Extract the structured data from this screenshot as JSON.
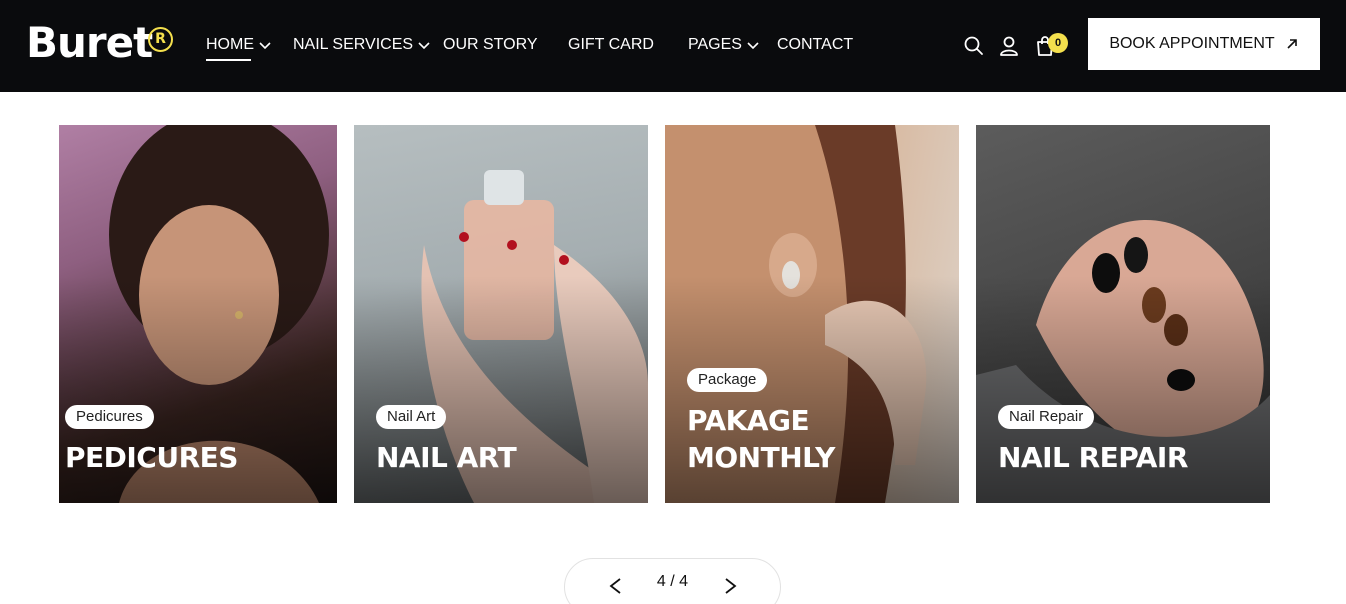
{
  "brand": {
    "name": "Buret",
    "mark": "R"
  },
  "nav": {
    "home": "HOME",
    "nail_services": "NAIL SERVICES",
    "our_story": "OUR STORY",
    "gift_card": "GIFT CARD",
    "pages": "PAGES",
    "contact": "CONTACT"
  },
  "header_icons": {
    "search": "search-icon",
    "user": "user-icon",
    "cart": "cart-icon"
  },
  "cart": {
    "count": "0"
  },
  "cta": {
    "label": "BOOK APPOINTMENT",
    "icon": "arrow-up-right-icon"
  },
  "cards": [
    {
      "tag": "Pedicures",
      "title": "PEDICURES"
    },
    {
      "tag": "Nail Art",
      "title": "NAIL ART"
    },
    {
      "tag": "Package",
      "title_line1": "PAKAGE",
      "title_line2": "MONTHLY"
    },
    {
      "tag": "Nail Repair",
      "title": "NAIL REPAIR"
    }
  ],
  "pagination": {
    "label": "4 / 4"
  },
  "colors": {
    "header_bg": "#0a0b0d",
    "accent": "#f4e04d",
    "white": "#ffffff"
  }
}
